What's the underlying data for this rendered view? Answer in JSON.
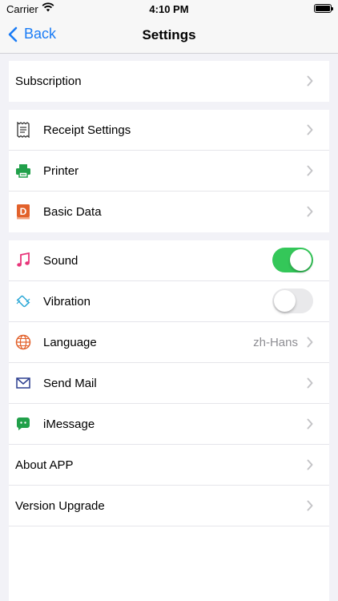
{
  "status": {
    "carrier": "Carrier",
    "time": "4:10 PM"
  },
  "nav": {
    "back_label": "Back",
    "title": "Settings"
  },
  "groups": {
    "subscription": {
      "label": "Subscription"
    },
    "receipt": {
      "label": "Receipt Settings",
      "icon": "receipt-icon"
    },
    "printer": {
      "label": "Printer",
      "icon": "printer-icon",
      "color": "#21a04a"
    },
    "basic": {
      "label": "Basic Data",
      "icon": "basic-data-icon",
      "color": "#e2612b"
    },
    "sound": {
      "label": "Sound",
      "icon": "music-note-icon",
      "color": "#e8357a",
      "enabled": true
    },
    "vibration": {
      "label": "Vibration",
      "icon": "vibration-icon",
      "color": "#2aa7d6",
      "enabled": false
    },
    "language": {
      "label": "Language",
      "value": "zh-Hans",
      "icon": "globe-icon",
      "color": "#e2612b"
    },
    "mail": {
      "label": "Send Mail",
      "icon": "mail-icon",
      "color": "#2c3e8f"
    },
    "imessage": {
      "label": "iMessage",
      "icon": "message-icon",
      "color": "#21a04a"
    },
    "about": {
      "label": "About APP"
    },
    "upgrade": {
      "label": "Version Upgrade"
    }
  },
  "colors": {
    "accent": "#1a7cf6",
    "toggle_on": "#34c759"
  }
}
